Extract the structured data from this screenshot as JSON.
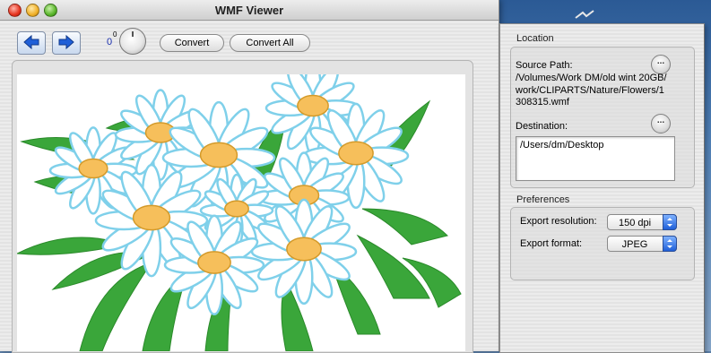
{
  "window": {
    "title": "WMF Viewer"
  },
  "toolbar": {
    "knob_value": "0",
    "knob_superscript": "0",
    "convert_label": "Convert",
    "convert_all_label": "Convert All"
  },
  "location": {
    "title": "Location",
    "source_path_label": "Source Path:",
    "source_path_value": "/Volumes/Work DM/old wint 20GB/work/CLIPARTS/Nature/Flowers/1308315.wmf",
    "destination_label": "Destination:",
    "destination_value": "/Users/dm/Desktop",
    "browse_label": "..."
  },
  "preferences": {
    "title": "Preferences",
    "export_resolution_label": "Export resolution:",
    "export_resolution_value": "150 dpi",
    "export_format_label": "Export format:",
    "export_format_value": "JPEG"
  },
  "icons": {
    "back": "back-arrow-icon",
    "forward": "forward-arrow-icon",
    "popup_arrows": "popup-arrows-icon"
  },
  "colors": {
    "accent": "#1f5fd8",
    "knob_value": "#1a2fae",
    "flower_petal": "#ffffff",
    "flower_outline": "#7fd0ea",
    "flower_center": "#f6bf5b",
    "leaf": "#3aa63a"
  }
}
